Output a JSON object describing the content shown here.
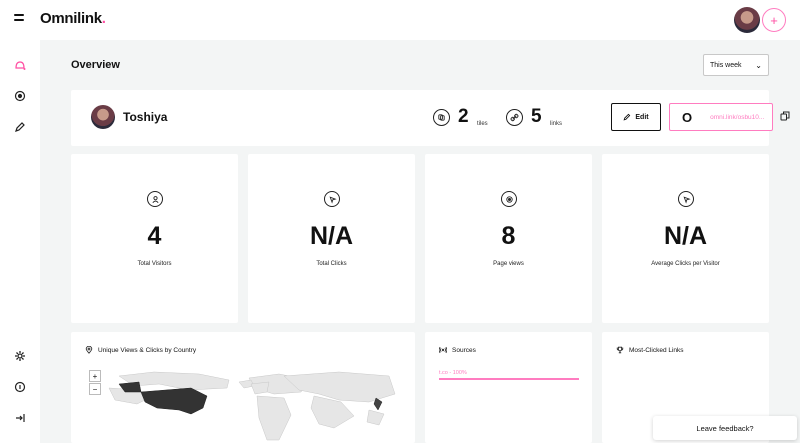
{
  "app": {
    "brand": "Omnilink",
    "brand_dot": "."
  },
  "header": {
    "avatar_alt": "user-avatar",
    "add_symbol": "+"
  },
  "sidebar": {
    "items": [
      {
        "name": "overview",
        "icon": "home-icon",
        "active": true
      },
      {
        "name": "analytics",
        "icon": "target-icon"
      },
      {
        "name": "editor",
        "icon": "pencil-icon"
      },
      {
        "name": "settings",
        "icon": "gear-icon"
      },
      {
        "name": "help",
        "icon": "info-icon"
      },
      {
        "name": "logout",
        "icon": "logout-icon"
      }
    ]
  },
  "page": {
    "title": "Overview",
    "period": {
      "selected": "This week"
    }
  },
  "profile": {
    "name": "Toshiya",
    "tiles": {
      "count": "2",
      "unit": "tiles"
    },
    "links": {
      "count": "5",
      "unit": "links"
    },
    "edit_label": "Edit",
    "link_prefix": "O",
    "link_url": "omni.link/osbu10..."
  },
  "metrics": [
    {
      "value": "4",
      "label": "Total Visitors",
      "icon": "user-icon"
    },
    {
      "value": "N/A",
      "label": "Total Clicks",
      "icon": "cursor-icon"
    },
    {
      "value": "8",
      "label": "Page views",
      "icon": "target-icon"
    },
    {
      "value": "N/A",
      "label": "Average Clicks per Visitor",
      "icon": "cursor-icon"
    }
  ],
  "panels": {
    "map": {
      "title": "Unique Views & Clicks by Country",
      "zoom_in": "+",
      "zoom_out": "−"
    },
    "sources": {
      "title": "Sources",
      "items": [
        {
          "label": "t.co - 100%",
          "percent": 100
        }
      ]
    },
    "most_clicked": {
      "title": "Most-Clicked Links"
    }
  },
  "feedback": {
    "label": "Leave feedback?"
  },
  "colors": {
    "accent": "#ff4fa3",
    "accent_light": "#ff7cc0",
    "background": "#f3f5f5",
    "highlight_country": "#2b2b2b"
  }
}
